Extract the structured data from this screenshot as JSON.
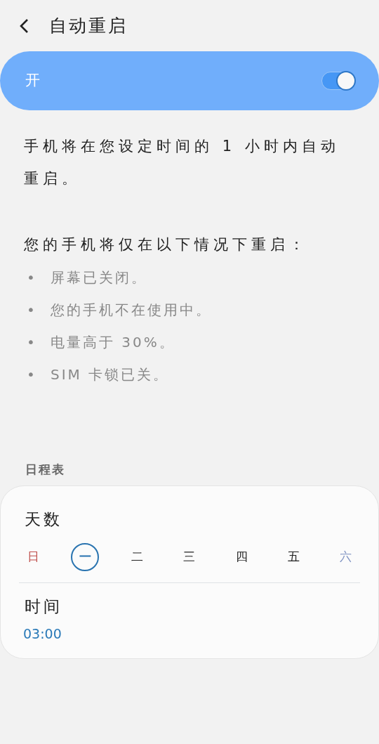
{
  "header": {
    "title": "自动重启"
  },
  "master_switch": {
    "label": "开",
    "on": true
  },
  "description": "手机将在您设定时间的 1 小时内自动重启。",
  "conditions_title": "您的手机将仅在以下情况下重启：",
  "conditions": [
    {
      "bullet": "•",
      "text": "屏幕已关闭。"
    },
    {
      "bullet": "•",
      "text": "您的手机不在使用中。"
    },
    {
      "bullet": "•",
      "text": "电量高于 30%。"
    },
    {
      "bullet": "•",
      "text": "SIM 卡锁已关。"
    }
  ],
  "section_label": "日程表",
  "schedule": {
    "days_label": "天数",
    "days": [
      {
        "label": "日",
        "selected": false,
        "color": "#c0504d"
      },
      {
        "label": "一",
        "selected": true
      },
      {
        "label": "二",
        "selected": false
      },
      {
        "label": "三",
        "selected": false
      },
      {
        "label": "四",
        "selected": false
      },
      {
        "label": "五",
        "selected": false
      },
      {
        "label": "六",
        "selected": false,
        "color": "#7f93c2"
      }
    ],
    "time_label": "时间",
    "time_value": "03:00"
  }
}
